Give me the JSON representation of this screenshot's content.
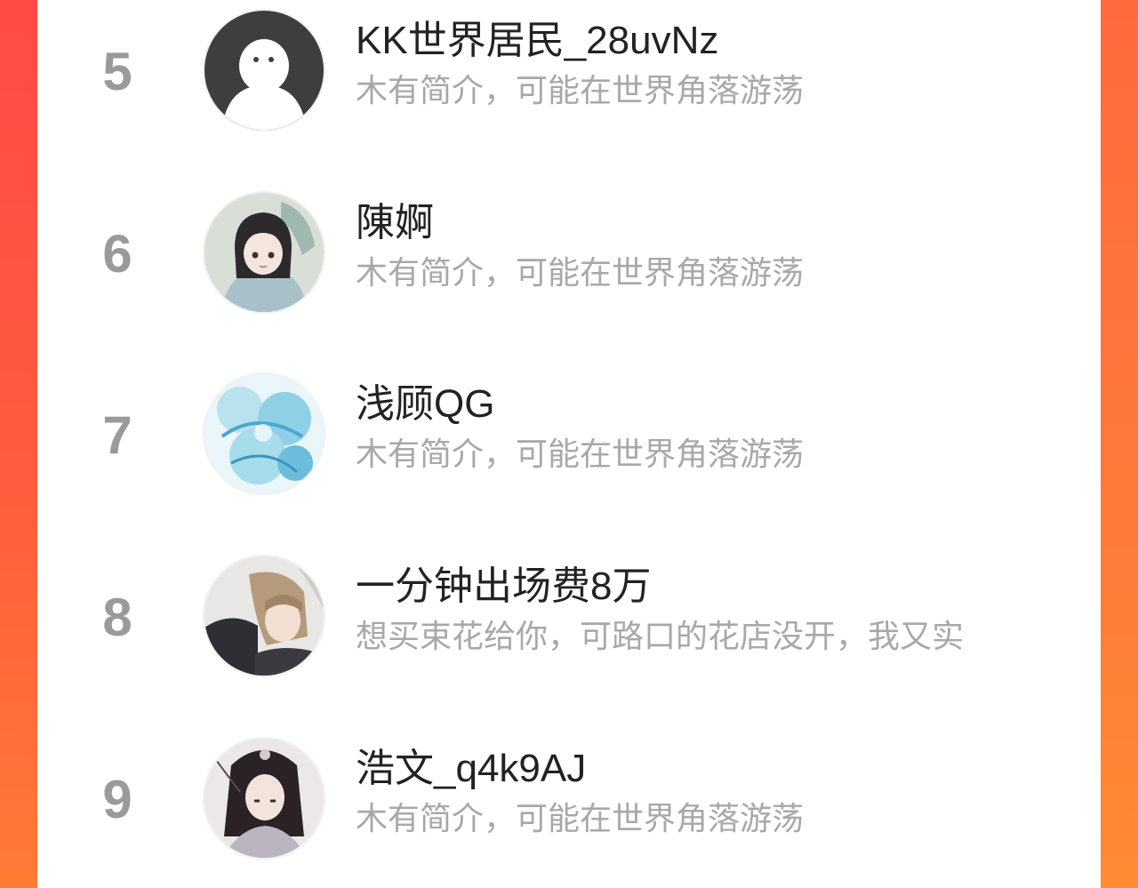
{
  "leaderboard": {
    "items": [
      {
        "rank": "5",
        "name": "KK世界居民_28uvNz",
        "bio": "木有简介，可能在世界角落游荡",
        "avatar_icon": "default-ghost-avatar"
      },
      {
        "rank": "6",
        "name": "陳婀",
        "bio": "木有简介，可能在世界角落游荡",
        "avatar_icon": "anime-girl-avatar"
      },
      {
        "rank": "7",
        "name": "浅顾QG",
        "bio": "木有简介，可能在世界角落游荡",
        "avatar_icon": "blue-watercolor-avatar"
      },
      {
        "rank": "8",
        "name": "一分钟出场费8万",
        "bio": "想买束花给你，可路口的花店没开，我又实",
        "avatar_icon": "anime-couple-avatar"
      },
      {
        "rank": "9",
        "name": "浩文_q4k9AJ",
        "bio": "木有简介，可能在世界角落游荡",
        "avatar_icon": "anime-warrior-avatar"
      }
    ]
  },
  "colors": {
    "background_left": "#ff4a45",
    "background_right": "#ff7a35",
    "rank_text": "#9a9a9a",
    "name_text": "#222222",
    "bio_text": "#a8a8a8"
  }
}
